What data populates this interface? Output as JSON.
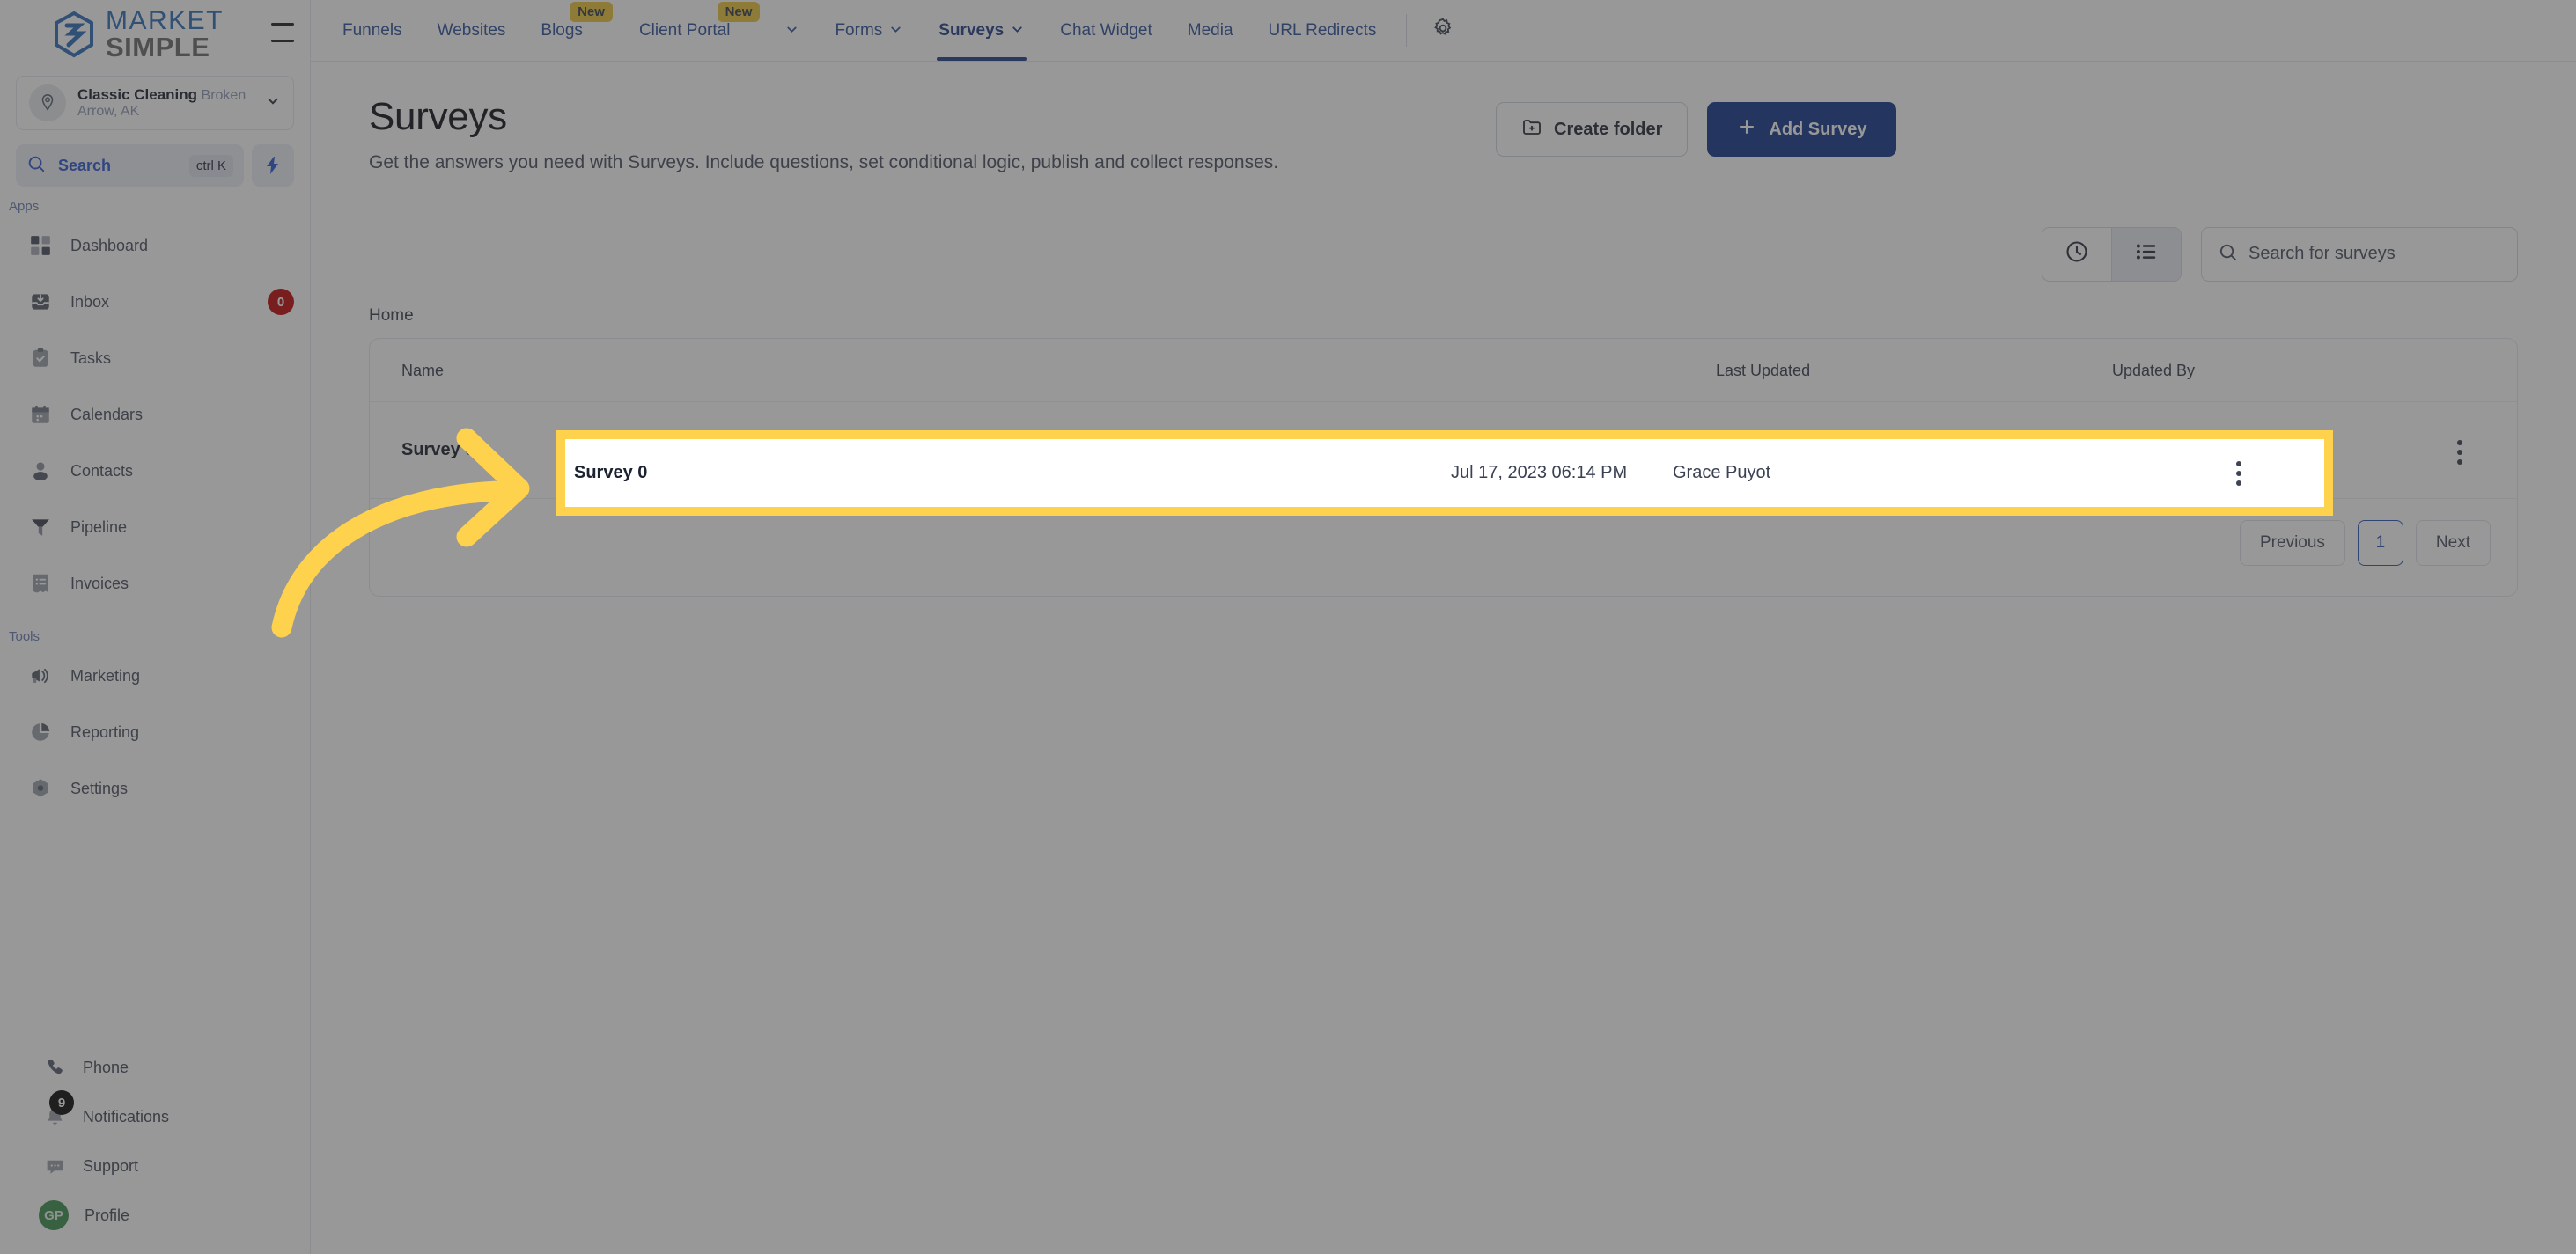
{
  "brand": {
    "name_top": "MARKET",
    "name_bottom": "SIMPLE",
    "logo_icon": "market-simple-logo",
    "hamburger_icon": "hamburger-menu-icon"
  },
  "location": {
    "name": "Classic Cleaning",
    "sub": "Broken Arrow, AK",
    "pin_icon": "map-pin-icon",
    "chevron_icon": "chevron-down-icon"
  },
  "sidebar_search": {
    "label": "Search",
    "shortcut": "ctrl K",
    "search_icon": "search-icon",
    "bolt_icon": "lightning-bolt-icon"
  },
  "sidebar": {
    "group_apps": "Apps",
    "group_tools": "Tools",
    "apps": [
      {
        "label": "Dashboard",
        "icon": "dashboard-grid-icon",
        "badge": ""
      },
      {
        "label": "Inbox",
        "icon": "inbox-icon",
        "badge": "0"
      },
      {
        "label": "Tasks",
        "icon": "clipboard-check-icon",
        "badge": ""
      },
      {
        "label": "Calendars",
        "icon": "calendar-icon",
        "badge": ""
      },
      {
        "label": "Contacts",
        "icon": "user-icon",
        "badge": ""
      },
      {
        "label": "Pipeline",
        "icon": "funnel-icon",
        "badge": ""
      },
      {
        "label": "Invoices",
        "icon": "invoice-list-icon",
        "badge": ""
      }
    ],
    "tools": [
      {
        "label": "Marketing",
        "icon": "megaphone-icon"
      },
      {
        "label": "Reporting",
        "icon": "pie-chart-icon"
      },
      {
        "label": "Settings",
        "icon": "gear-hex-icon"
      }
    ],
    "bottom": [
      {
        "label": "Phone",
        "icon": "phone-icon",
        "badge": ""
      },
      {
        "label": "Notifications",
        "icon": "bell-icon",
        "badge": "9"
      },
      {
        "label": "Support",
        "icon": "chat-dots-icon",
        "badge": ""
      },
      {
        "label": "Profile",
        "icon": "avatar",
        "badge": "",
        "initials": "GP"
      }
    ]
  },
  "topnav": {
    "items": [
      {
        "label": "Funnels",
        "badge": "",
        "caret": false,
        "active": false
      },
      {
        "label": "Websites",
        "badge": "",
        "caret": false,
        "active": false
      },
      {
        "label": "Blogs",
        "badge": "New",
        "caret": false,
        "active": false
      },
      {
        "label": "Client Portal",
        "badge": "New",
        "caret": true,
        "active": false
      },
      {
        "label": "Forms",
        "badge": "",
        "caret": true,
        "active": false
      },
      {
        "label": "Surveys",
        "badge": "",
        "caret": true,
        "active": true
      },
      {
        "label": "Chat Widget",
        "badge": "",
        "caret": false,
        "active": false
      },
      {
        "label": "Media",
        "badge": "",
        "caret": false,
        "active": false
      },
      {
        "label": "URL Redirects",
        "badge": "",
        "caret": false,
        "active": false
      }
    ],
    "gear_icon": "gear-icon"
  },
  "page": {
    "title": "Surveys",
    "subtitle": "Get the answers you need with Surveys. Include questions, set conditional logic, publish and collect responses.",
    "create_folder_label": "Create folder",
    "create_folder_icon": "folder-plus-icon",
    "add_survey_label": "Add Survey",
    "add_survey_icon": "plus-icon"
  },
  "toolbar": {
    "recent_icon": "clock-icon",
    "list_icon": "list-view-icon",
    "active_view": "list",
    "search_placeholder": "Search for surveys",
    "search_value": "",
    "search_icon": "search-icon"
  },
  "breadcrumb": "Home",
  "table": {
    "columns": [
      "Name",
      "Last Updated",
      "Updated By",
      ""
    ],
    "rows": [
      {
        "name": "Survey 0",
        "last_updated": "Jul 17, 2023 06:14 PM",
        "updated_by": "Grace Puyot",
        "menu_icon": "more-vertical-icon"
      }
    ]
  },
  "pagination": {
    "previous": "Previous",
    "current_page": "1",
    "next": "Next"
  },
  "annotation": {
    "arrow_icon": "curved-arrow-right-icon",
    "highlight_color": "#ffd24d",
    "overlay_color": "#313131"
  },
  "colors": {
    "primary": "#17388c",
    "link": "#31539c",
    "badge_new": "#ecc53f",
    "badge_unread": "#c10a0a",
    "avatar_green": "#3f9152"
  }
}
